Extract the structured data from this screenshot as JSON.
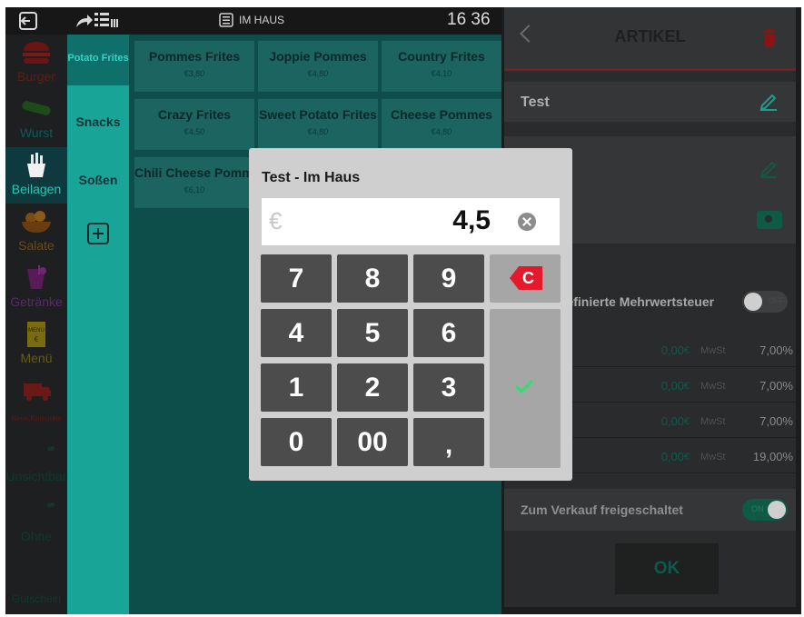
{
  "topbar": {
    "mode_label": "IM HAUS",
    "clock": "16 36"
  },
  "categories": [
    {
      "label": "Burger"
    },
    {
      "label": "Wurst"
    },
    {
      "label": "Beilagen"
    },
    {
      "label": "Salate"
    },
    {
      "label": "Getränke"
    },
    {
      "label": "Menü",
      "icon_text": "MENU"
    },
    {
      "label": "Neue Kategorie"
    },
    {
      "label": "Unsichtbar"
    },
    {
      "label": "Ohne"
    },
    {
      "label": "Gutschein"
    }
  ],
  "subcategories": [
    {
      "label": "Potato Frites"
    },
    {
      "label": "Snacks"
    },
    {
      "label": "Soßen"
    }
  ],
  "products": [
    {
      "name": "Pommes Frites",
      "price": "€3,80"
    },
    {
      "name": "Joppie Pommes",
      "price": "€4,80"
    },
    {
      "name": "Country Frites",
      "price": "€4,10"
    },
    {
      "name": "Crazy Frites",
      "price": "€4,50"
    },
    {
      "name": "Sweet Potato Frites",
      "price": "€4,80"
    },
    {
      "name": "Cheese Pommes",
      "price": "€4,80"
    },
    {
      "name": "Chili Cheese Pommes",
      "price": "€6,10"
    }
  ],
  "panel": {
    "title": "ARTIKEL",
    "article_name": "Test",
    "vat_label": "Benutzerdefinierte Mehrwertsteuer",
    "vat_toggle": "OFF",
    "vat_rows": [
      {
        "amount": "0,00",
        "currency": "€",
        "label": "MwSt",
        "rate": "7,00%"
      },
      {
        "amount": "0,00",
        "currency": "€",
        "label": "MwSt",
        "rate": "7,00%"
      },
      {
        "amount": "0,00",
        "currency": "€",
        "label": "MwSt",
        "rate": "7,00%"
      },
      {
        "amount": "0,00",
        "currency": "€",
        "label": "MwSt",
        "rate": "19,00%"
      }
    ],
    "sale_label": "Zum Verkauf freigeschaltet",
    "sale_toggle": "ON",
    "ok_label": "OK"
  },
  "dialog": {
    "title": "Test - Im Haus",
    "currency": "€",
    "value": "4,5",
    "keys": [
      "7",
      "8",
      "9",
      "4",
      "5",
      "6",
      "1",
      "2",
      "3",
      "0",
      "00",
      ","
    ],
    "clear_label": "C"
  },
  "colors": {
    "accent": "#18a597",
    "delete": "#e4192c",
    "confirm": "#2ee06e"
  }
}
